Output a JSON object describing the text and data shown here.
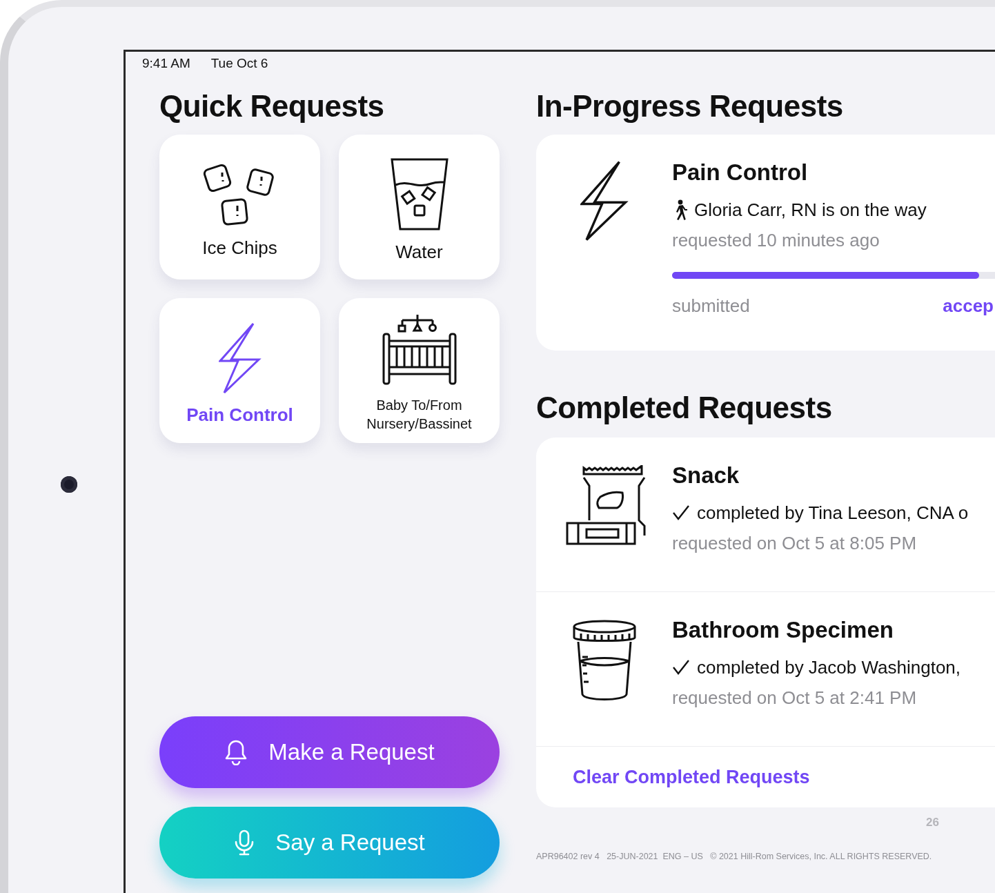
{
  "status_bar": {
    "time": "9:41 AM",
    "date": "Tue Oct 6"
  },
  "quick_requests": {
    "title": "Quick Requests",
    "tiles": [
      {
        "label": "Ice Chips",
        "kind": "ice",
        "selected": false
      },
      {
        "label": "Water",
        "kind": "water",
        "selected": false
      },
      {
        "label": "Pain Control",
        "kind": "bolt",
        "selected": true
      },
      {
        "label": "Baby To/From Nursery/Bassinet",
        "kind": "crib",
        "selected": false
      }
    ]
  },
  "actions": [
    {
      "label": "Make a Request",
      "kind": "bell"
    },
    {
      "label": "Say a Request",
      "kind": "mic"
    }
  ],
  "in_progress": {
    "title": "In-Progress Requests",
    "items": [
      {
        "title": "Pain Control",
        "kind": "bolt",
        "status": "Gloria Carr, RN is on the way",
        "requested": "requested 10 minutes ago",
        "level": 0.9,
        "steps": [
          {
            "label": "submitted",
            "selected": false
          },
          {
            "label": "accep",
            "selected": true
          }
        ]
      }
    ]
  },
  "completed": {
    "title": "Completed Requests",
    "items": [
      {
        "title": "Snack",
        "kind": "snack",
        "status": "completed by Tina Leeson, CNA o",
        "requested": "requested on Oct 5 at 8:05 PM"
      },
      {
        "title": "Bathroom Specimen",
        "kind": "specimen",
        "status": "completed by Jacob Washington,",
        "requested": "requested on Oct 5 at 2:41 PM"
      }
    ],
    "clear_link": "Clear Completed Requests"
  },
  "footer": {
    "page_number": "26",
    "legal": "APR96402 rev 4   25-JUN-2021  ENG – US   © 2021 Hill-Rom Services, Inc. ALL RIGHTS RESERVED."
  }
}
